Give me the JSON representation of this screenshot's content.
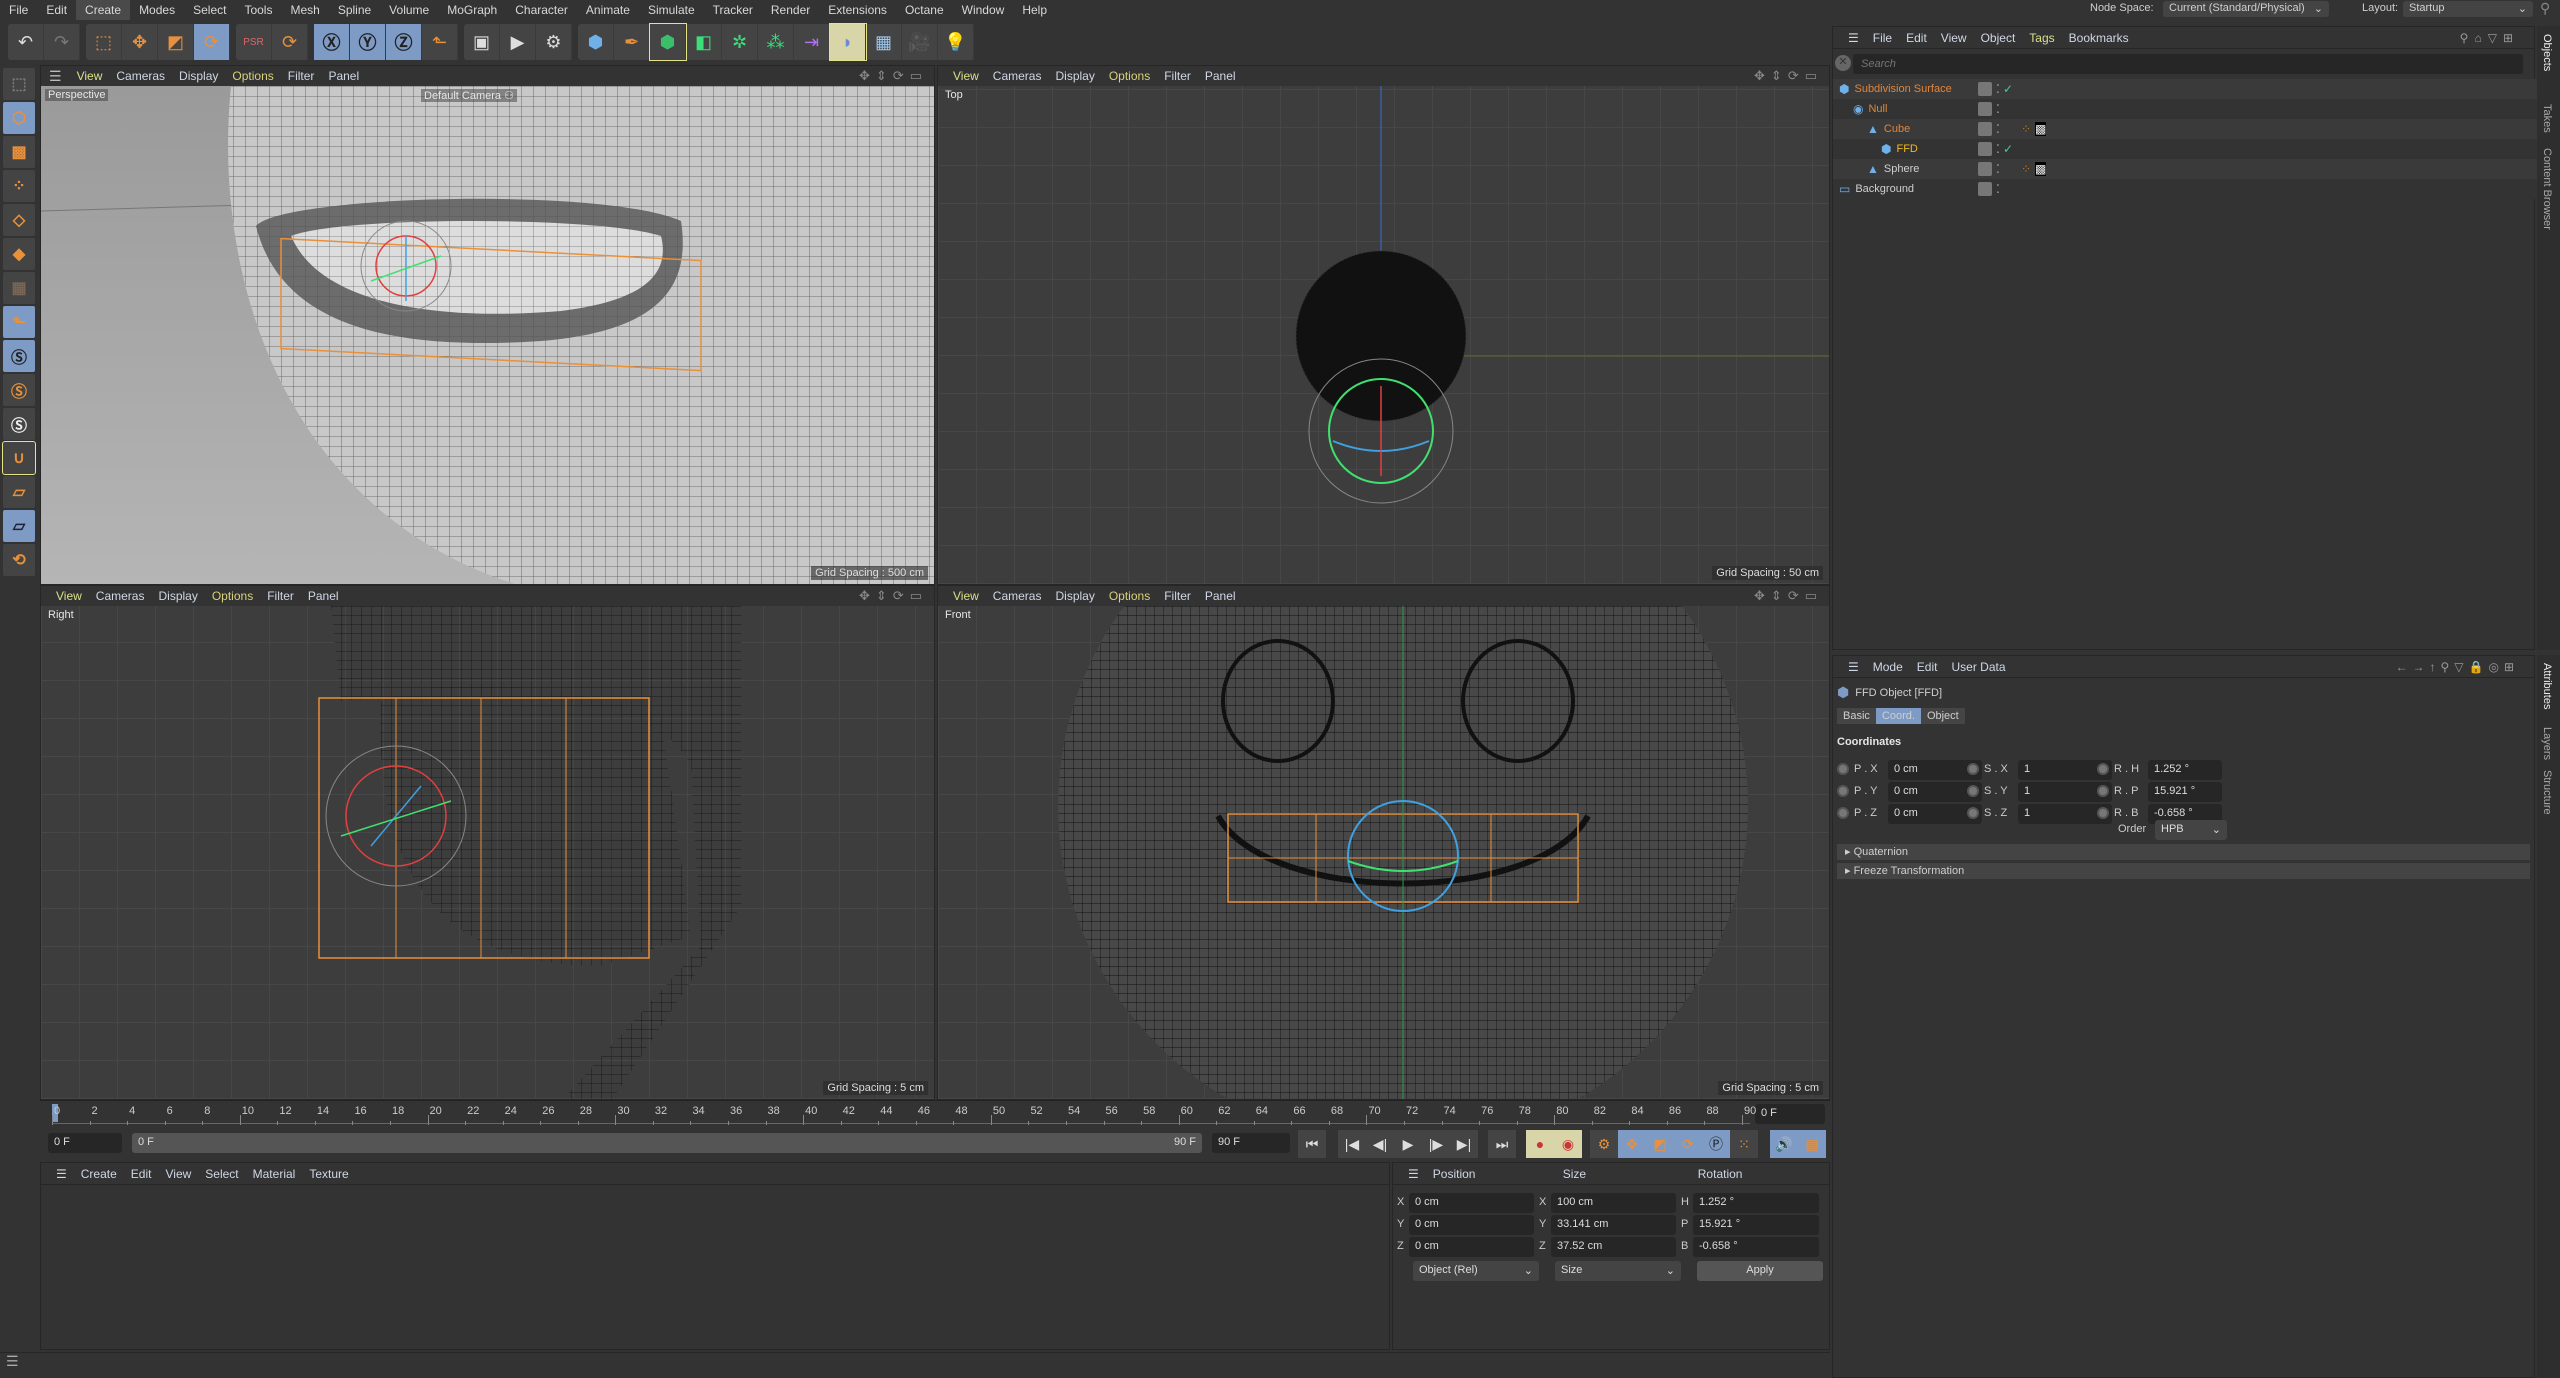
{
  "menu": [
    "File",
    "Edit",
    "Create",
    "Modes",
    "Select",
    "Tools",
    "Mesh",
    "Spline",
    "Volume",
    "MoGraph",
    "Character",
    "Animate",
    "Simulate",
    "Tracker",
    "Render",
    "Extensions",
    "Octane",
    "Window",
    "Help"
  ],
  "menu_active": "Create",
  "node_space": {
    "label": "Node Space:",
    "value": "Current (Standard/Physical)"
  },
  "layout": {
    "label": "Layout:",
    "value": "Startup"
  },
  "toolbar_icons": [
    "undo-icon",
    "redo-icon",
    "live-selection-icon",
    "move-icon",
    "scale-icon",
    "rotate-icon",
    "psr-icon",
    "recent-tools-icon",
    "x-axis-icon",
    "y-axis-icon",
    "z-axis-icon",
    "coordinate-system-icon",
    "render-view-icon",
    "render-picture-viewer-icon",
    "render-settings-icon",
    "cube-icon",
    "pen-icon",
    "subdivision-surface-icon",
    "extrude-icon",
    "cloner-icon",
    "mograph-icon",
    "bend-icon",
    "deformer-icon",
    "floor-icon",
    "camera-icon",
    "light-icon"
  ],
  "viewport_menu": {
    "view": "View",
    "cameras": "Cameras",
    "display": "Display",
    "options": "Options",
    "filter": "Filter",
    "panel": "Panel"
  },
  "viewports": [
    {
      "name": "Perspective",
      "camera": "Default Camera",
      "grid": "Grid Spacing : 500 cm"
    },
    {
      "name": "Top",
      "camera": "",
      "grid": "Grid Spacing : 50 cm"
    },
    {
      "name": "Right",
      "camera": "",
      "grid": "Grid Spacing : 5 cm"
    },
    {
      "name": "Front",
      "camera": "",
      "grid": "Grid Spacing : 5 cm"
    }
  ],
  "timeline": {
    "ticks": [
      "0",
      "2",
      "4",
      "6",
      "8",
      "10",
      "12",
      "14",
      "16",
      "18",
      "20",
      "22",
      "24",
      "26",
      "28",
      "30",
      "32",
      "34",
      "36",
      "38",
      "40",
      "42",
      "44",
      "46",
      "48",
      "50",
      "52",
      "54",
      "56",
      "58",
      "60",
      "62",
      "64",
      "66",
      "68",
      "70",
      "72",
      "74",
      "76",
      "78",
      "80",
      "82",
      "84",
      "86",
      "88",
      "90"
    ],
    "current": "0 F",
    "start": "0 F",
    "range_start": "0 F",
    "range_end": "90 F",
    "end": "90 F"
  },
  "material_menu": [
    "Create",
    "Edit",
    "View",
    "Select",
    "Material",
    "Texture"
  ],
  "coords": {
    "headers": {
      "position": "Position",
      "size": "Size",
      "rotation": "Rotation"
    },
    "rows": [
      {
        "axis": "X",
        "pos": "0 cm",
        "saxis": "X",
        "size": "100 cm",
        "raxis": "H",
        "rot": "1.252 °"
      },
      {
        "axis": "Y",
        "pos": "0 cm",
        "saxis": "Y",
        "size": "33.141 cm",
        "raxis": "P",
        "rot": "15.921 °"
      },
      {
        "axis": "Z",
        "pos": "0 cm",
        "saxis": "Z",
        "size": "37.52 cm",
        "raxis": "B",
        "rot": "-0.658 °"
      }
    ],
    "mode": "Object (Rel)",
    "size_mode": "Size",
    "apply": "Apply"
  },
  "objects": {
    "menu": [
      "File",
      "Edit",
      "View",
      "Object",
      "Tags",
      "Bookmarks"
    ],
    "search_placeholder": "Search",
    "items": [
      {
        "name": "Subdivision Surface",
        "indent": 0,
        "color": "#e0853a",
        "check": true,
        "tags": false
      },
      {
        "name": "Null",
        "indent": 1,
        "color": "#e0853a",
        "check": false,
        "tags": false
      },
      {
        "name": "Cube",
        "indent": 2,
        "color": "#e0853a",
        "check": false,
        "tags": true
      },
      {
        "name": "FFD",
        "indent": 3,
        "color": "#f2b824",
        "check": true,
        "tags": false
      },
      {
        "name": "Sphere",
        "indent": 2,
        "color": "#cfcfcf",
        "check": false,
        "tags": true
      },
      {
        "name": "Background",
        "indent": 0,
        "color": "#cfcfcf",
        "check": false,
        "tags": false
      }
    ]
  },
  "side_tabs_top": [
    "Objects",
    "Takes",
    "Content Browser"
  ],
  "side_tabs_bottom": [
    "Attributes",
    "Layers",
    "Structure"
  ],
  "attributes": {
    "menu": [
      "Mode",
      "Edit",
      "User Data"
    ],
    "title": "FFD Object [FFD]",
    "tabs": [
      "Basic",
      "Coord.",
      "Object"
    ],
    "active_tab": "Coord.",
    "section": "Coordinates",
    "rows": [
      {
        "p": "P . X",
        "pv": "0 cm",
        "s": "S . X",
        "sv": "1",
        "r": "R . H",
        "rv": "1.252 °"
      },
      {
        "p": "P . Y",
        "pv": "0 cm",
        "s": "S . Y",
        "sv": "1",
        "r": "R . P",
        "rv": "15.921 °"
      },
      {
        "p": "P . Z",
        "pv": "0 cm",
        "s": "S . Z",
        "sv": "1",
        "r": "R . B",
        "rv": "-0.658 °"
      }
    ],
    "order_label": "Order",
    "order": "HPB",
    "groups": [
      "Quaternion",
      "Freeze Transformation"
    ]
  },
  "colors": {
    "accent": "#7e9bc6",
    "orange": "#e8903a",
    "ffd": "#f2b824"
  }
}
